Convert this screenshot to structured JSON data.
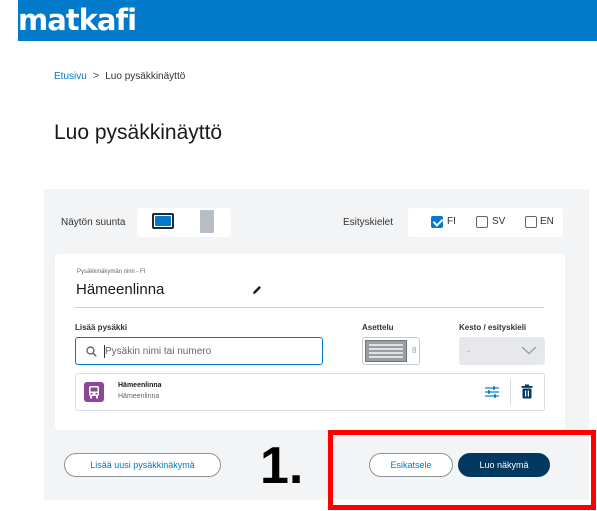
{
  "brand": {
    "logo_text": "matkafi",
    "color": "#007ac9"
  },
  "breadcrumb": {
    "home": "Etusivu",
    "separator": ">",
    "current": "Luo pysäkkinäyttö"
  },
  "page": {
    "title": "Luo pysäkkinäyttö"
  },
  "settings": {
    "orientation_label": "Näytön suunta",
    "orientation_selected": "horizontal",
    "languages_label": "Esityskielet",
    "languages": [
      {
        "code": "FI",
        "checked": true
      },
      {
        "code": "SV",
        "checked": false
      },
      {
        "code": "EN",
        "checked": false
      }
    ]
  },
  "view_card": {
    "name_label": "Pysäkkinäkymän nimi - FI",
    "name_value": "Hämeenlinna",
    "add_stop_label": "Lisää pysäkki",
    "search_placeholder": "Pysäkin nimi tai numero",
    "layout_label": "Asettelu",
    "layout_value": "8",
    "duration_label": "Kesto / esityskieli",
    "duration_value": "-",
    "stops": [
      {
        "name": "Hämeenlinna",
        "city": "Hämeenlinna",
        "icon": "bus-stop-icon"
      }
    ]
  },
  "actions": {
    "add_view_label": "Lisää uusi pysäkkinäkymä",
    "preview_label": "Esikatsele",
    "create_label": "Luo näkymä"
  },
  "annotation": {
    "step_label": "1.",
    "highlight_color": "#ff0000"
  },
  "colors": {
    "primary_dark": "#00385f",
    "stop_purple": "#8c4799",
    "panel_bg": "#f3f4f6"
  }
}
